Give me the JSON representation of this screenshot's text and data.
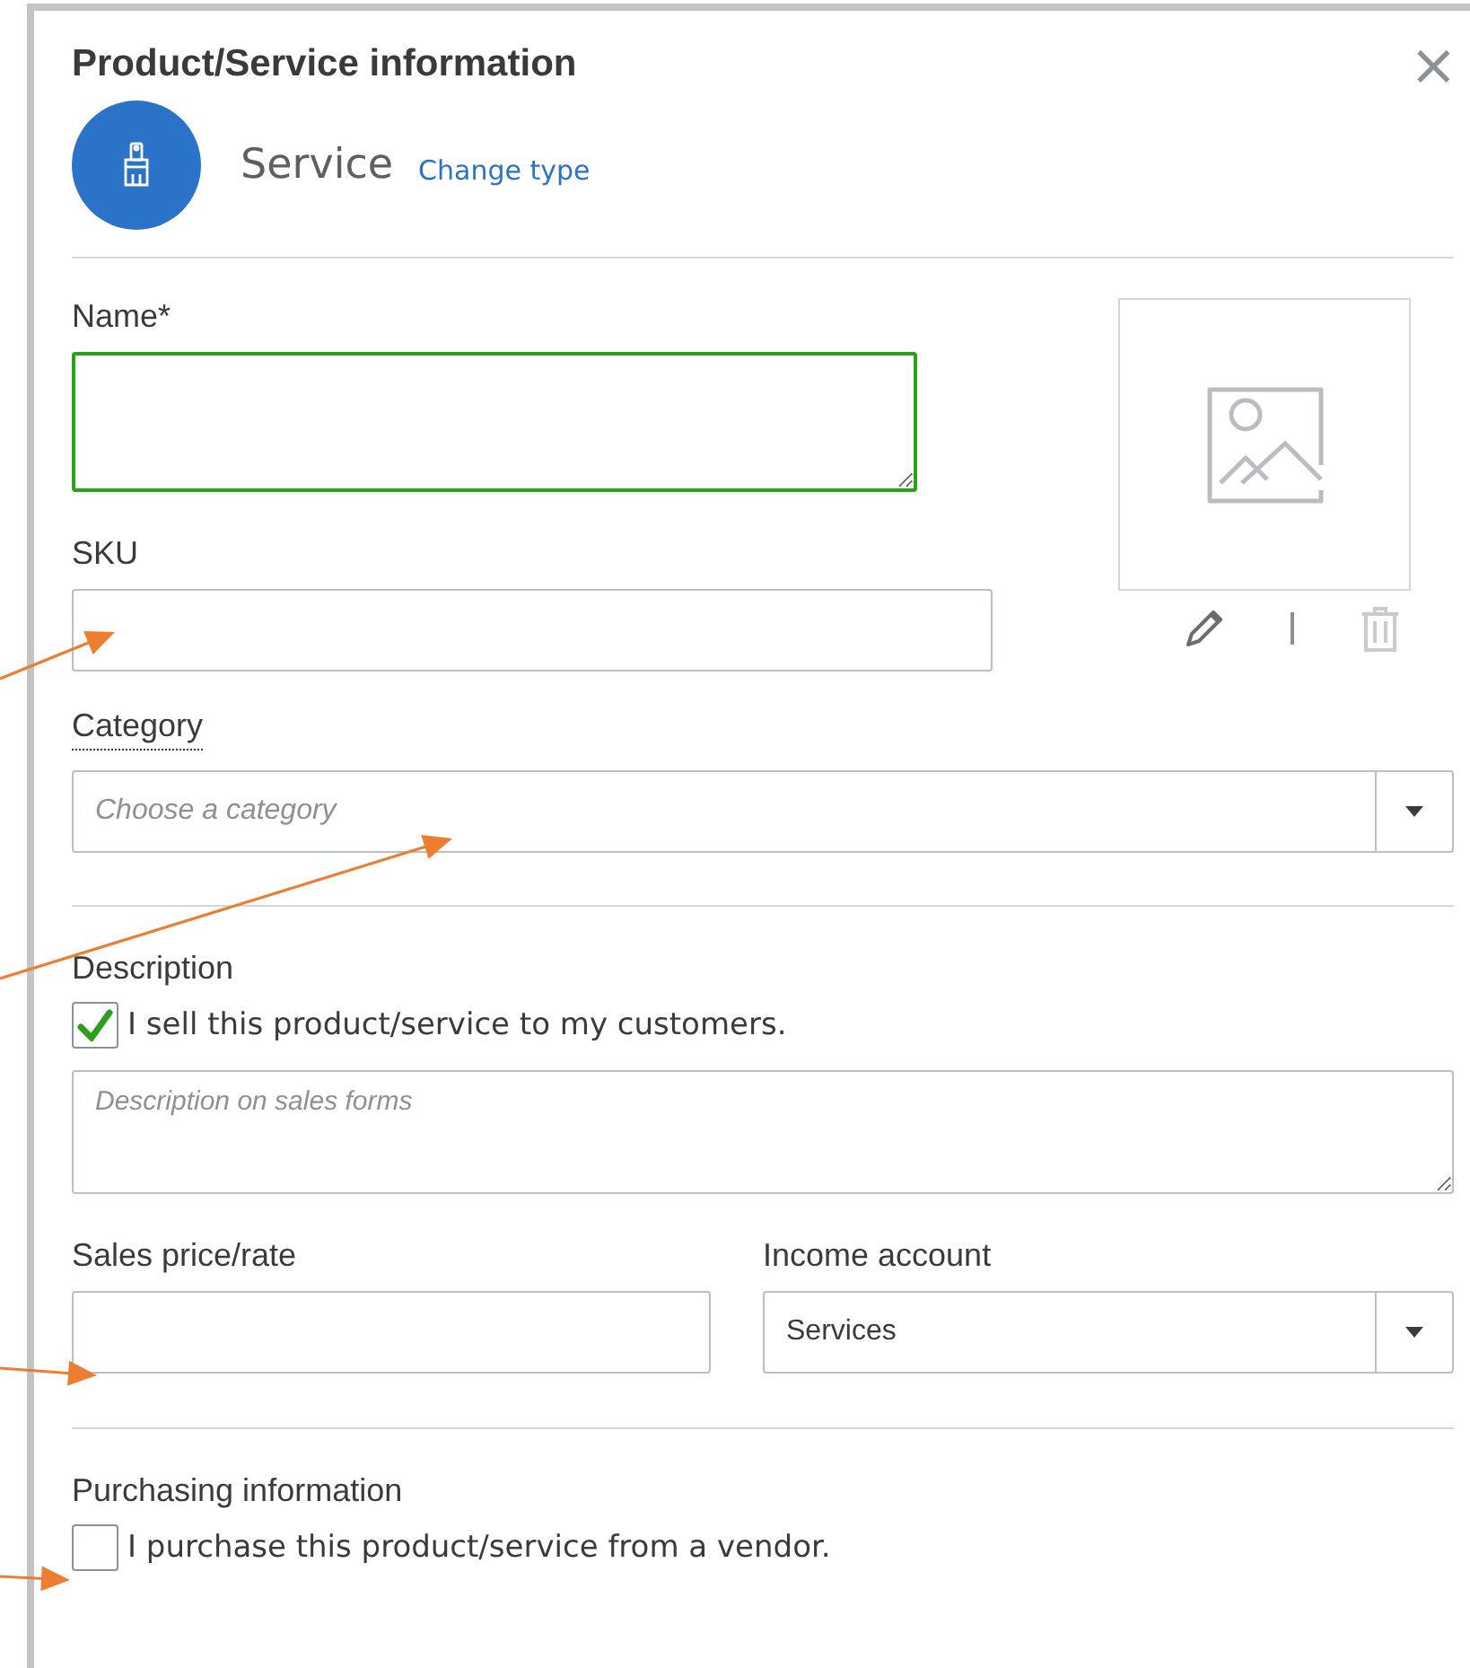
{
  "dialog": {
    "title": "Product/Service information",
    "close": "×"
  },
  "item_type": {
    "label": "Service",
    "link": "Change type"
  },
  "name_field": {
    "label": "Name*",
    "focused": true
  },
  "sku_field": {
    "label": "SKU"
  },
  "category": {
    "label": "Category",
    "placeholder": "Choose a category"
  },
  "description": {
    "label": "Description",
    "checkbox": {
      "label": "I sell this product/service to my customers.",
      "checked": true
    },
    "placeholder": "Description on sales forms"
  },
  "sales_price": {
    "label": "Sales price/rate"
  },
  "income_account": {
    "label": "Income account",
    "value": "Services"
  },
  "purchasing": {
    "label": "Purchasing information",
    "checkbox": {
      "label": "I purchase this product/service from a vendor.",
      "checked": false
    }
  }
}
